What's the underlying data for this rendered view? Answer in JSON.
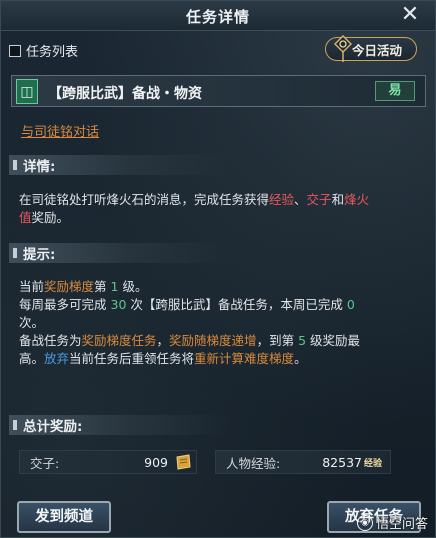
{
  "window": {
    "title": "任务详情"
  },
  "toolbar": {
    "quest_list_label": "任务列表",
    "today_activity_label": "今日活动"
  },
  "quest": {
    "emblem": "◫",
    "title": "【跨服比武】备战・物资",
    "difficulty": "易",
    "talk_link": "与司徒铭对话"
  },
  "details": {
    "heading": "详情:",
    "text_1": "在司徒铭处打听烽火石的消息，完成任务获得",
    "exp": "经验",
    "sep_1": "、",
    "jiaozi": "交子",
    "and": "和",
    "beacon_1": "烽火",
    "beacon_2": "值",
    "reward_suffix": "奖励。"
  },
  "tips": {
    "heading": "提示:",
    "l1_a": "当前",
    "l1_b": "奖励梯度",
    "l1_c": "第",
    "l1_d": "1",
    "l1_e": "级。",
    "l2_a": "每周最多可完成",
    "l2_b": "30",
    "l2_c": "次【跨服比武】备战任务，本周已完成",
    "l2_d": "0",
    "l2_e": "次。",
    "l3_a": "备战任务为",
    "l3_b": "奖励梯度任务",
    "l3_c": "，",
    "l3_d": "奖励随梯度递增",
    "l3_e": "，到第",
    "l3_f": "5",
    "l3_g": "级奖励最",
    "l4_a": "高。",
    "l4_b": "放弃",
    "l4_c": "当前任务后重领任务将",
    "l4_d": "重新计算难度梯度",
    "l4_e": "。"
  },
  "rewards": {
    "heading": "总计奖励:",
    "jiaozi_label": "交子:",
    "jiaozi_value": "909",
    "exp_label": "人物经验:",
    "exp_value": "82537",
    "exp_icon_text": "经验"
  },
  "buttons": {
    "channel": "发到频道",
    "abandon": "放弃任务"
  },
  "watermark": {
    "text": "悟空问答"
  },
  "colors": {
    "red": "#e8585b",
    "orange": "#d98a3c",
    "green": "#5bc489",
    "blue": "#4a9be0"
  }
}
